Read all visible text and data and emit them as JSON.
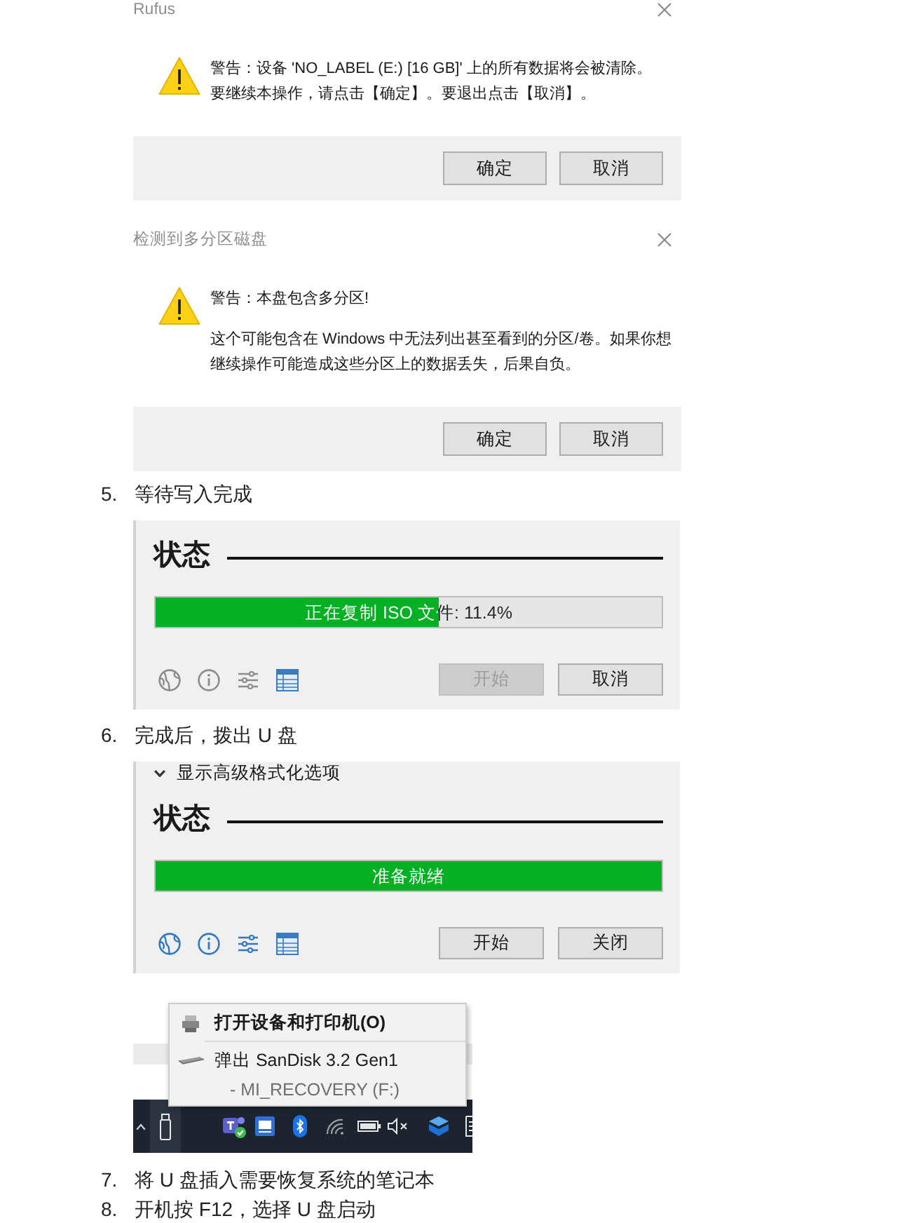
{
  "content": [
    {
      "kind": "dialog",
      "title": "Rufus",
      "message": [
        "警告：设备 'NO_LABEL (E:) [16 GB]' 上的所有数据将会被清除。",
        "要继续本操作，请点击【确定】。要退出点击【取消】。"
      ],
      "buttons": [
        "确定",
        "取消"
      ]
    },
    {
      "kind": "dialog",
      "title": "检测到多分区磁盘",
      "heading": "警告：本盘包含多分区!",
      "message": [
        "这个可能包含在 Windows 中无法列出甚至看到的分区/卷。如果你想继续操作可能造成这些分区上的数据丢失，后果自负。"
      ],
      "buttons": [
        "确定",
        "取消"
      ]
    },
    {
      "kind": "step",
      "number": "5.",
      "text": "等待写入完成"
    },
    {
      "kind": "status_panel",
      "heading": "状态",
      "progress": {
        "text": "正在复制 ISO 文件: 11.4%",
        "level": 0.56
      },
      "icons_enabled": false,
      "buttons": [
        {
          "label": "开始",
          "disabled": true
        },
        {
          "label": "取消",
          "disabled": false
        }
      ]
    },
    {
      "kind": "step",
      "number": "6.",
      "text": "完成后，拨出 U 盘"
    },
    {
      "kind": "status_panel",
      "advanced_toggle": "显示高级格式化选项",
      "heading": "状态",
      "progress": {
        "text": "准备就绪",
        "level": 1
      },
      "icons_enabled": true,
      "buttons": [
        {
          "label": "开始",
          "disabled": false
        },
        {
          "label": "关闭",
          "disabled": false
        }
      ]
    },
    {
      "kind": "tray_screenshot",
      "menu": [
        {
          "kind": "devices",
          "label": "打开设备和打印机(O)",
          "default": true
        },
        {
          "kind": "eject",
          "label": "弹出 SanDisk 3.2 Gen1",
          "default": false
        },
        {
          "kind": "volume",
          "label": "- MI_RECOVERY (F:)"
        }
      ]
    },
    {
      "kind": "step",
      "number": "7.",
      "text": "将 U 盘插入需要恢复系统的笔记本"
    },
    {
      "kind": "step",
      "number": "8.",
      "text": "开机按 F12，选择 U 盘启动"
    }
  ]
}
